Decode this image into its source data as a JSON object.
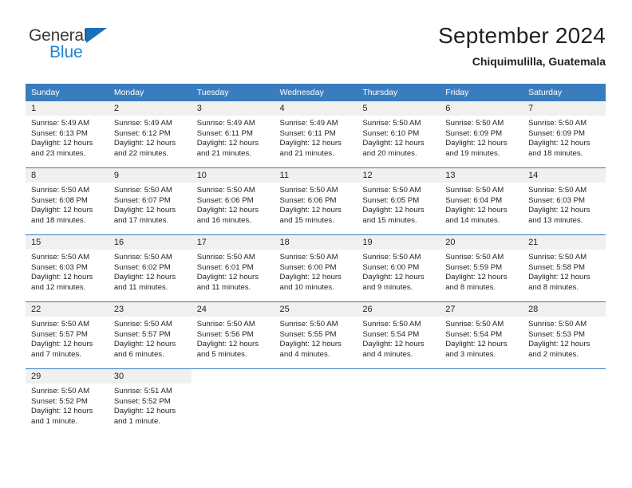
{
  "brand": {
    "name_top": "General",
    "name_bottom": "Blue",
    "triangle_icon": "triangle-logo-icon",
    "color_top": "#3b3b3b",
    "color_bottom": "#1b84d4"
  },
  "header": {
    "title": "September 2024",
    "subtitle": "Chiquimulilla, Guatemala"
  },
  "theme": {
    "header_blue": "#3a7dbf",
    "daynum_band": "#f0f0f0",
    "text": "#231f20",
    "page_bg": "#ffffff"
  },
  "weekday_headers": [
    "Sunday",
    "Monday",
    "Tuesday",
    "Wednesday",
    "Thursday",
    "Friday",
    "Saturday"
  ],
  "labels": {
    "sunrise_prefix": "Sunrise:",
    "sunset_prefix": "Sunset:",
    "daylight_prefix": "Daylight:"
  },
  "weeks": [
    [
      {
        "day": "1",
        "sunrise": "Sunrise: 5:49 AM",
        "sunset": "Sunset: 6:13 PM",
        "daylight1": "Daylight: 12 hours",
        "daylight2": "and 23 minutes."
      },
      {
        "day": "2",
        "sunrise": "Sunrise: 5:49 AM",
        "sunset": "Sunset: 6:12 PM",
        "daylight1": "Daylight: 12 hours",
        "daylight2": "and 22 minutes."
      },
      {
        "day": "3",
        "sunrise": "Sunrise: 5:49 AM",
        "sunset": "Sunset: 6:11 PM",
        "daylight1": "Daylight: 12 hours",
        "daylight2": "and 21 minutes."
      },
      {
        "day": "4",
        "sunrise": "Sunrise: 5:49 AM",
        "sunset": "Sunset: 6:11 PM",
        "daylight1": "Daylight: 12 hours",
        "daylight2": "and 21 minutes."
      },
      {
        "day": "5",
        "sunrise": "Sunrise: 5:50 AM",
        "sunset": "Sunset: 6:10 PM",
        "daylight1": "Daylight: 12 hours",
        "daylight2": "and 20 minutes."
      },
      {
        "day": "6",
        "sunrise": "Sunrise: 5:50 AM",
        "sunset": "Sunset: 6:09 PM",
        "daylight1": "Daylight: 12 hours",
        "daylight2": "and 19 minutes."
      },
      {
        "day": "7",
        "sunrise": "Sunrise: 5:50 AM",
        "sunset": "Sunset: 6:09 PM",
        "daylight1": "Daylight: 12 hours",
        "daylight2": "and 18 minutes."
      }
    ],
    [
      {
        "day": "8",
        "sunrise": "Sunrise: 5:50 AM",
        "sunset": "Sunset: 6:08 PM",
        "daylight1": "Daylight: 12 hours",
        "daylight2": "and 18 minutes."
      },
      {
        "day": "9",
        "sunrise": "Sunrise: 5:50 AM",
        "sunset": "Sunset: 6:07 PM",
        "daylight1": "Daylight: 12 hours",
        "daylight2": "and 17 minutes."
      },
      {
        "day": "10",
        "sunrise": "Sunrise: 5:50 AM",
        "sunset": "Sunset: 6:06 PM",
        "daylight1": "Daylight: 12 hours",
        "daylight2": "and 16 minutes."
      },
      {
        "day": "11",
        "sunrise": "Sunrise: 5:50 AM",
        "sunset": "Sunset: 6:06 PM",
        "daylight1": "Daylight: 12 hours",
        "daylight2": "and 15 minutes."
      },
      {
        "day": "12",
        "sunrise": "Sunrise: 5:50 AM",
        "sunset": "Sunset: 6:05 PM",
        "daylight1": "Daylight: 12 hours",
        "daylight2": "and 15 minutes."
      },
      {
        "day": "13",
        "sunrise": "Sunrise: 5:50 AM",
        "sunset": "Sunset: 6:04 PM",
        "daylight1": "Daylight: 12 hours",
        "daylight2": "and 14 minutes."
      },
      {
        "day": "14",
        "sunrise": "Sunrise: 5:50 AM",
        "sunset": "Sunset: 6:03 PM",
        "daylight1": "Daylight: 12 hours",
        "daylight2": "and 13 minutes."
      }
    ],
    [
      {
        "day": "15",
        "sunrise": "Sunrise: 5:50 AM",
        "sunset": "Sunset: 6:03 PM",
        "daylight1": "Daylight: 12 hours",
        "daylight2": "and 12 minutes."
      },
      {
        "day": "16",
        "sunrise": "Sunrise: 5:50 AM",
        "sunset": "Sunset: 6:02 PM",
        "daylight1": "Daylight: 12 hours",
        "daylight2": "and 11 minutes."
      },
      {
        "day": "17",
        "sunrise": "Sunrise: 5:50 AM",
        "sunset": "Sunset: 6:01 PM",
        "daylight1": "Daylight: 12 hours",
        "daylight2": "and 11 minutes."
      },
      {
        "day": "18",
        "sunrise": "Sunrise: 5:50 AM",
        "sunset": "Sunset: 6:00 PM",
        "daylight1": "Daylight: 12 hours",
        "daylight2": "and 10 minutes."
      },
      {
        "day": "19",
        "sunrise": "Sunrise: 5:50 AM",
        "sunset": "Sunset: 6:00 PM",
        "daylight1": "Daylight: 12 hours",
        "daylight2": "and 9 minutes."
      },
      {
        "day": "20",
        "sunrise": "Sunrise: 5:50 AM",
        "sunset": "Sunset: 5:59 PM",
        "daylight1": "Daylight: 12 hours",
        "daylight2": "and 8 minutes."
      },
      {
        "day": "21",
        "sunrise": "Sunrise: 5:50 AM",
        "sunset": "Sunset: 5:58 PM",
        "daylight1": "Daylight: 12 hours",
        "daylight2": "and 8 minutes."
      }
    ],
    [
      {
        "day": "22",
        "sunrise": "Sunrise: 5:50 AM",
        "sunset": "Sunset: 5:57 PM",
        "daylight1": "Daylight: 12 hours",
        "daylight2": "and 7 minutes."
      },
      {
        "day": "23",
        "sunrise": "Sunrise: 5:50 AM",
        "sunset": "Sunset: 5:57 PM",
        "daylight1": "Daylight: 12 hours",
        "daylight2": "and 6 minutes."
      },
      {
        "day": "24",
        "sunrise": "Sunrise: 5:50 AM",
        "sunset": "Sunset: 5:56 PM",
        "daylight1": "Daylight: 12 hours",
        "daylight2": "and 5 minutes."
      },
      {
        "day": "25",
        "sunrise": "Sunrise: 5:50 AM",
        "sunset": "Sunset: 5:55 PM",
        "daylight1": "Daylight: 12 hours",
        "daylight2": "and 4 minutes."
      },
      {
        "day": "26",
        "sunrise": "Sunrise: 5:50 AM",
        "sunset": "Sunset: 5:54 PM",
        "daylight1": "Daylight: 12 hours",
        "daylight2": "and 4 minutes."
      },
      {
        "day": "27",
        "sunrise": "Sunrise: 5:50 AM",
        "sunset": "Sunset: 5:54 PM",
        "daylight1": "Daylight: 12 hours",
        "daylight2": "and 3 minutes."
      },
      {
        "day": "28",
        "sunrise": "Sunrise: 5:50 AM",
        "sunset": "Sunset: 5:53 PM",
        "daylight1": "Daylight: 12 hours",
        "daylight2": "and 2 minutes."
      }
    ],
    [
      {
        "day": "29",
        "sunrise": "Sunrise: 5:50 AM",
        "sunset": "Sunset: 5:52 PM",
        "daylight1": "Daylight: 12 hours",
        "daylight2": "and 1 minute."
      },
      {
        "day": "30",
        "sunrise": "Sunrise: 5:51 AM",
        "sunset": "Sunset: 5:52 PM",
        "daylight1": "Daylight: 12 hours",
        "daylight2": "and 1 minute."
      },
      {
        "day": "",
        "sunrise": "",
        "sunset": "",
        "daylight1": "",
        "daylight2": ""
      },
      {
        "day": "",
        "sunrise": "",
        "sunset": "",
        "daylight1": "",
        "daylight2": ""
      },
      {
        "day": "",
        "sunrise": "",
        "sunset": "",
        "daylight1": "",
        "daylight2": ""
      },
      {
        "day": "",
        "sunrise": "",
        "sunset": "",
        "daylight1": "",
        "daylight2": ""
      },
      {
        "day": "",
        "sunrise": "",
        "sunset": "",
        "daylight1": "",
        "daylight2": ""
      }
    ]
  ]
}
